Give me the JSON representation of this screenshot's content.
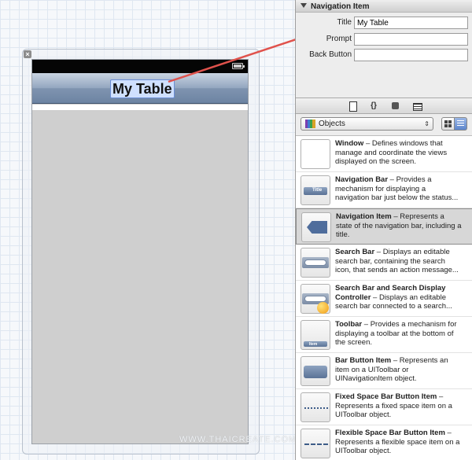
{
  "canvas": {
    "close_glyph": "×",
    "nav_title": "My Table"
  },
  "watermark": "WWW.THAICREATE.COM",
  "inspector": {
    "section_title": "Navigation Item",
    "fields": [
      {
        "label": "Title",
        "value": "My Table"
      },
      {
        "label": "Prompt",
        "value": ""
      },
      {
        "label": "Back Button",
        "value": ""
      }
    ]
  },
  "library": {
    "tab_icons": [
      "file-icon",
      "braces-icon",
      "cube-icon",
      "grid-icon"
    ],
    "braces_glyph": "{}",
    "selector_value": "Objects",
    "updown_glyph": "⇕",
    "items": [
      {
        "name": "Window",
        "desc": " – Defines windows that manage and coordinate the views displayed on the screen.",
        "icon": "window-thumb-icon"
      },
      {
        "name": "Navigation Bar",
        "desc": " – Provides a mechanism for displaying a navigation bar just below the status...",
        "icon": "navigation-bar-thumb-icon",
        "thumb_label": "Title"
      },
      {
        "name": "Navigation Item",
        "desc": " – Represents a state of the navigation bar, including a title.",
        "icon": "navigation-item-thumb-icon",
        "selected": true
      },
      {
        "name": "Search Bar",
        "desc": " – Displays an editable search bar, containing the search icon, that sends an action message...",
        "icon": "search-bar-thumb-icon"
      },
      {
        "name": "Search Bar and Search Display Controller",
        "desc": " – Displays an editable search bar connected to a search...",
        "icon": "search-display-controller-thumb-icon"
      },
      {
        "name": "Toolbar",
        "desc": " – Provides a mechanism for displaying a toolbar at the bottom of the screen.",
        "icon": "toolbar-thumb-icon",
        "thumb_label": "Item"
      },
      {
        "name": "Bar Button Item",
        "desc": " – Represents an item on a UIToolbar or UINavigationItem object.",
        "icon": "bar-button-item-thumb-icon"
      },
      {
        "name": "Fixed Space Bar Button Item",
        "desc": " – Represents a fixed space item on a UIToolbar object.",
        "icon": "fixed-space-thumb-icon"
      },
      {
        "name": "Flexible Space Bar Button Item",
        "desc": " – Represents a flexible space item on a UIToolbar object.",
        "icon": "flexible-space-thumb-icon"
      }
    ]
  },
  "colors": {
    "connector": "#e0524c",
    "nav_bar": "#7f94b0",
    "selection": "#cfe0ff"
  }
}
